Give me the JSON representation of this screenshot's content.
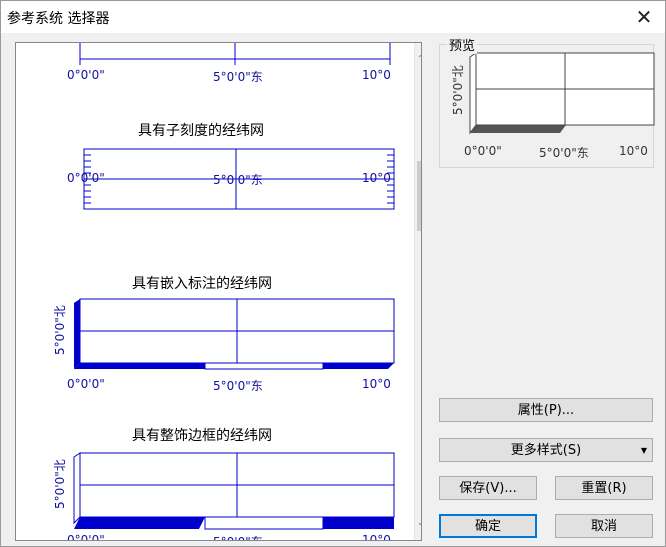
{
  "window": {
    "title": "参考系统 选择器",
    "close_glyph": "✕"
  },
  "list": {
    "items": [
      {
        "title": ""
      },
      {
        "title": "具有子刻度的经纬网"
      },
      {
        "title": "具有嵌入标注的经纬网"
      },
      {
        "title": "具有整饰边框的经纬网"
      }
    ],
    "labels": {
      "lon0": "0°0'0\"",
      "lon5": "5°0'0\"东",
      "lon10": "10°0",
      "lat5": "5°0'0\"北"
    },
    "scroll_up": "︿",
    "scroll_down": "﹀"
  },
  "preview": {
    "label": "预览",
    "labels": {
      "lon0": "0°0'0\"",
      "lon5": "5°0'0\"东",
      "lon10": "10°0",
      "lat5": "5°0'0\"北"
    }
  },
  "buttons": {
    "properties": "属性(P)...",
    "more_styles": "更多样式(S)",
    "save": "保存(V)...",
    "reset": "重置(R)",
    "ok": "确定",
    "cancel": "取消"
  },
  "colors": {
    "grid": "#0000cc",
    "accent": "#0078d7"
  }
}
